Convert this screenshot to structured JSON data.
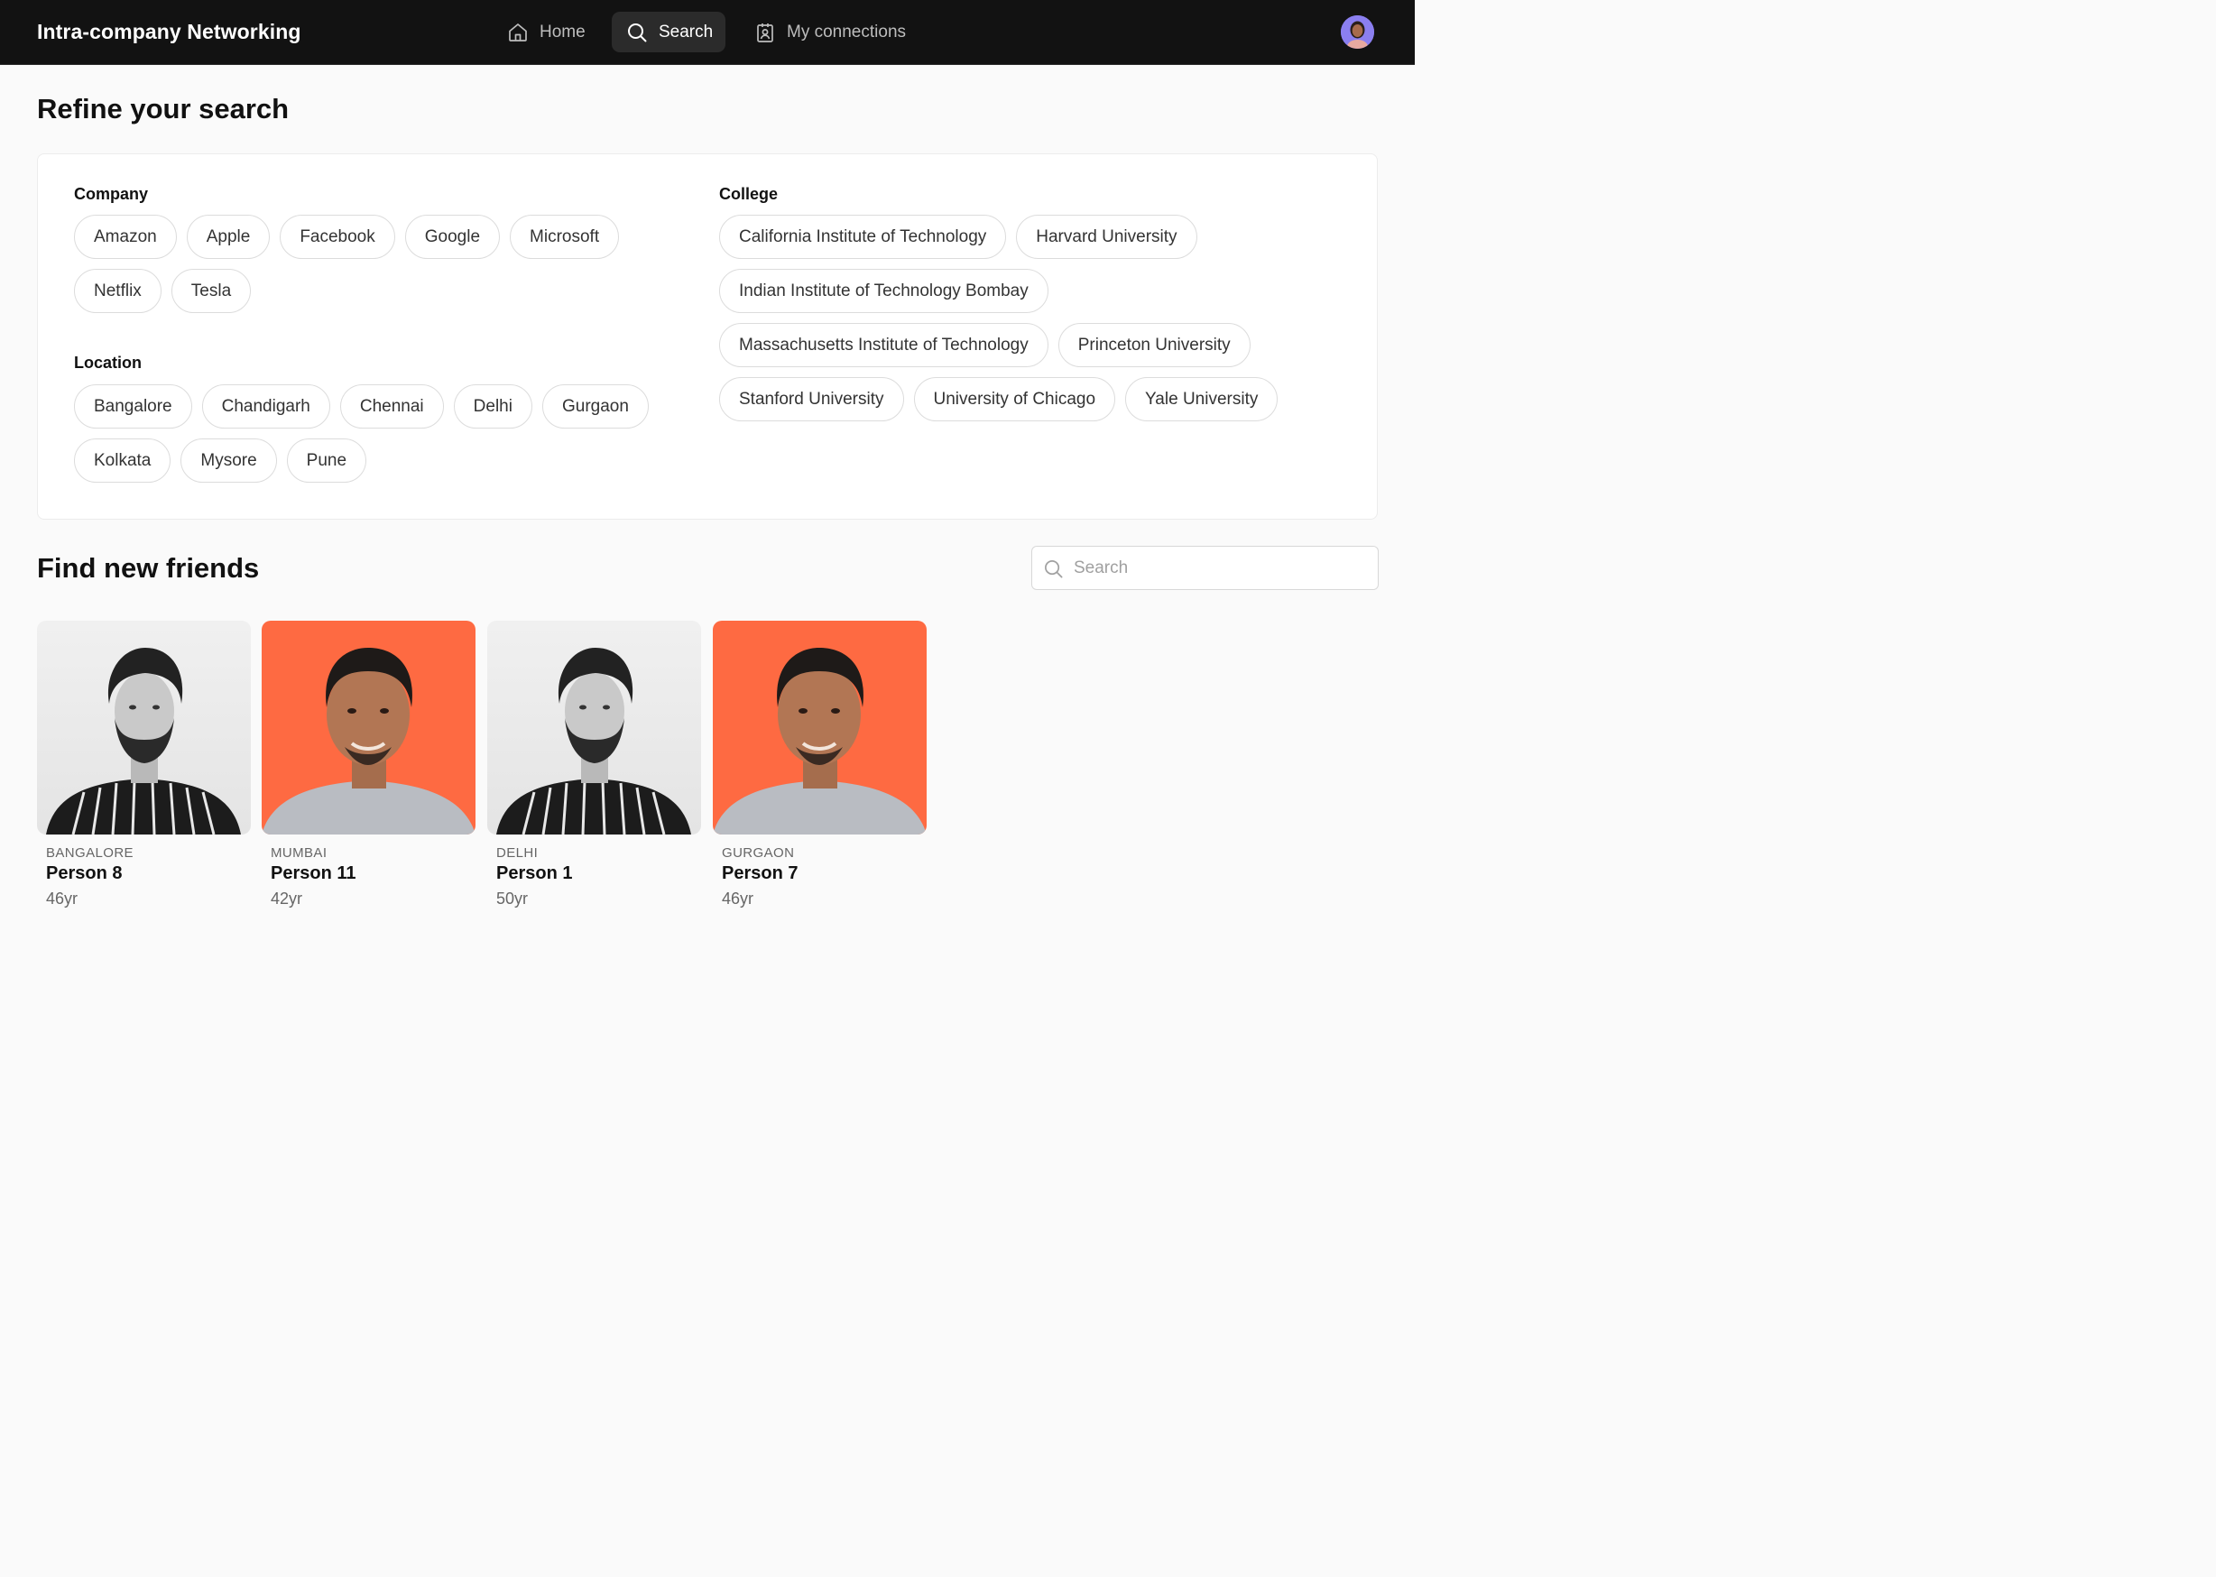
{
  "header": {
    "title": "Intra-company Networking",
    "nav": [
      {
        "label": "Home",
        "icon": "home-icon"
      },
      {
        "label": "Search",
        "icon": "search-icon",
        "active": true
      },
      {
        "label": "My connections",
        "icon": "contact-badge-icon"
      }
    ],
    "avatar_color": "#8b7ff0"
  },
  "refine": {
    "title": "Refine your search",
    "company": {
      "label": "Company",
      "options": [
        "Amazon",
        "Apple",
        "Facebook",
        "Google",
        "Microsoft",
        "Netflix",
        "Tesla"
      ]
    },
    "location": {
      "label": "Location",
      "options": [
        "Bangalore",
        "Chandigarh",
        "Chennai",
        "Delhi",
        "Gurgaon",
        "Kolkata",
        "Mysore",
        "Pune"
      ]
    },
    "college": {
      "label": "College",
      "options": [
        "California Institute of Technology",
        "Harvard University",
        "Indian Institute of Technology Bombay",
        "Massachusetts Institute of Technology",
        "Princeton University",
        "Stanford University",
        "University of Chicago",
        "Yale University"
      ]
    }
  },
  "friends": {
    "title": "Find new friends",
    "search_placeholder": "Search",
    "search_value": "",
    "people": [
      {
        "location": "BANGALORE",
        "name": "Person 8",
        "age": "46yr",
        "photo": "gray"
      },
      {
        "location": "MUMBAI",
        "name": "Person 11",
        "age": "42yr",
        "photo": "orange"
      },
      {
        "location": "DELHI",
        "name": "Person 1",
        "age": "50yr",
        "photo": "gray"
      },
      {
        "location": "GURGAON",
        "name": "Person 7",
        "age": "46yr",
        "photo": "orange"
      }
    ]
  },
  "colors": {
    "header_bg": "#121212",
    "page_bg": "#fafafa",
    "photo_orange": "#fe6a42"
  }
}
